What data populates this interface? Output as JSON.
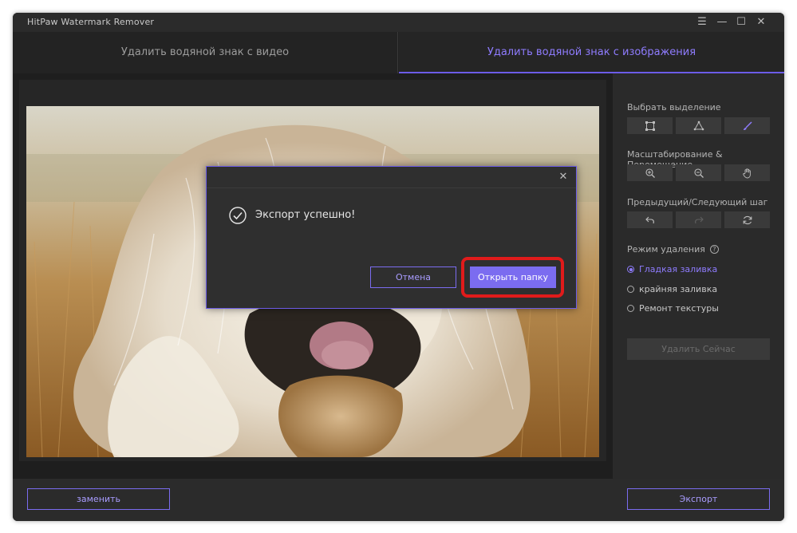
{
  "app": {
    "title": "HitPaw Watermark Remover"
  },
  "window_controls": {
    "menu_icon": "menu-icon",
    "minimize_icon": "minimize-icon",
    "maximize_icon": "maximize-icon",
    "close_icon": "close-icon"
  },
  "tabs": [
    {
      "label": "Удалить водяной знак с видео",
      "active": false
    },
    {
      "label": "Удалить водяной знак с изображения",
      "active": true
    }
  ],
  "sidebar": {
    "select_heading": "Выбрать выделение",
    "select_tools": [
      "rectangle-select-icon",
      "polygon-select-icon",
      "brush-select-icon"
    ],
    "zoom_heading": "Масштабирование & Перемещение",
    "zoom_tools": [
      "zoom-in-icon",
      "zoom-out-icon",
      "hand-pan-icon"
    ],
    "step_heading": "Предыдущий/Следующий шаг",
    "step_tools": [
      "undo-icon",
      "redo-icon",
      "reset-icon"
    ],
    "mode_heading": "Режим удаления",
    "modes": [
      {
        "label": "Гладкая заливка",
        "selected": true
      },
      {
        "label": "крайняя заливка",
        "selected": false
      },
      {
        "label": "Ремонт текстуры",
        "selected": false
      }
    ],
    "remove_now": "Удалить Сейчас"
  },
  "bottom": {
    "replace": "заменить",
    "export": "Экспорт"
  },
  "dialog": {
    "message": "Экспорт успешно!",
    "cancel": "Отмена",
    "open_folder": "Открыть папку"
  },
  "colors": {
    "accent": "#7b6cf0",
    "highlight": "#e01b1b",
    "background": "#2b2b2b"
  }
}
